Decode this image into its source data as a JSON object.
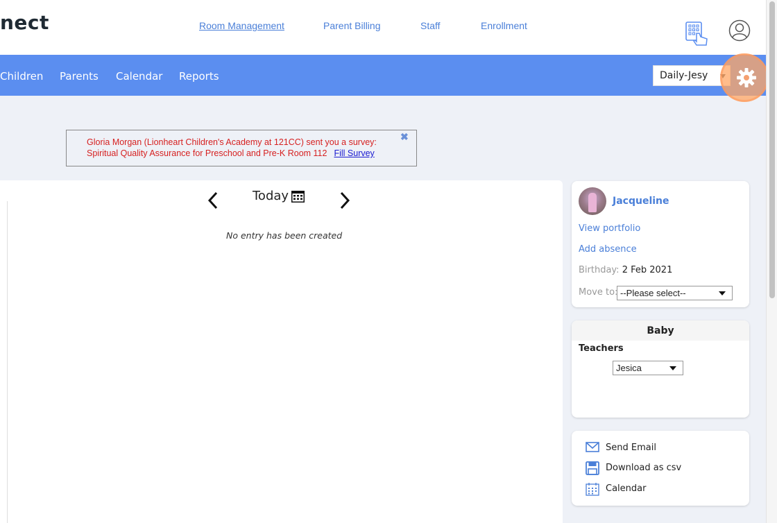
{
  "brand": {
    "text": "nect"
  },
  "top_nav": {
    "room_management": "Room Management",
    "parent_billing": "Parent Billing",
    "staff": "Staff",
    "enrollment": "Enrollment"
  },
  "main_nav": {
    "children": "Children",
    "parents": "Parents",
    "calendar": "Calendar",
    "reports": "Reports"
  },
  "room_select": {
    "value": "Daily-Jesy"
  },
  "survey": {
    "line1": "Gloria Morgan (Lionheart Children's Academy at 121CC) sent you a survey:",
    "line2": "Spiritual Quality Assurance for Preschool and Pre-K Room 112",
    "fill_link": "Fill Survey",
    "close": "✖"
  },
  "diary": {
    "date_label": "Today",
    "empty_message": "No entry has been created"
  },
  "child_card": {
    "name": "Jacqueline",
    "view_portfolio": "View portfolio",
    "add_absence": "Add absence",
    "birthday_label": "Birthday:",
    "birthday_value": "2 Feb 2021",
    "move_to_label": "Move to:",
    "move_to_value": "--Please select--"
  },
  "room_card": {
    "title": "Baby",
    "teachers_label": "Teachers",
    "teacher_value": "Jesica"
  },
  "actions": {
    "send_email": "Send Email",
    "download_csv": "Download as csv",
    "calendar": "Calendar"
  },
  "colors": {
    "nav_blue": "#5b8ef0",
    "link_blue": "#4a7fd8",
    "survey_red": "#d62020",
    "highlight_orange": "#ffa564"
  }
}
